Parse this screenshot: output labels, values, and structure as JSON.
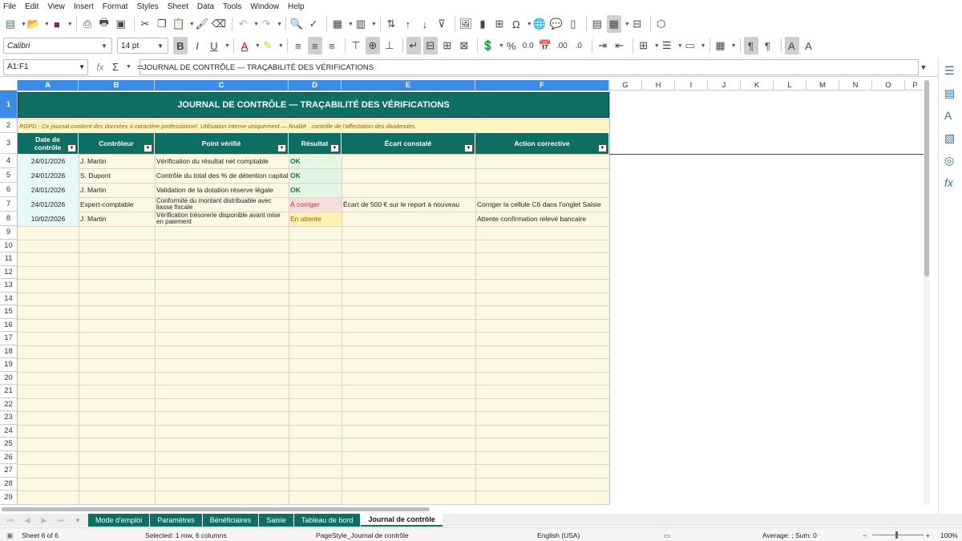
{
  "menu": [
    "File",
    "Edit",
    "View",
    "Insert",
    "Format",
    "Styles",
    "Sheet",
    "Data",
    "Tools",
    "Window",
    "Help"
  ],
  "format": {
    "font": "Calibri",
    "size": "14 pt"
  },
  "formula_bar": {
    "cell_ref": "A1:F1",
    "content": "JOURNAL DE CONTRÔLE — TRAÇABILITÉ DES VÉRIFICATIONS"
  },
  "columns": [
    "A",
    "B",
    "C",
    "D",
    "E",
    "F",
    "G",
    "H",
    "I",
    "J",
    "K",
    "L",
    "M",
    "N",
    "O",
    "P"
  ],
  "rows": [
    "1",
    "2",
    "3",
    "4",
    "5",
    "6",
    "7",
    "8",
    "9",
    "10",
    "11",
    "12",
    "13",
    "14",
    "15",
    "16",
    "17",
    "18",
    "19",
    "20",
    "21",
    "22",
    "23",
    "24",
    "25",
    "26",
    "27",
    "28",
    "29"
  ],
  "sheet": {
    "title": "JOURNAL DE CONTRÔLE — TRAÇABILITÉ DES VÉRIFICATIONS",
    "note": "RGPD : Ce journal contient des données à caractère professionnel. Utilisation interne uniquement — finalité : contrôle de l'affectation des dividendes.",
    "headers": [
      "Date de contrôle",
      "Contrôleur",
      "Point vérifié",
      "Résultat",
      "Écart constaté",
      "Action corrective"
    ],
    "data": [
      [
        "24/01/2026",
        "J. Martin",
        "Vérification du résultat net comptable",
        "OK",
        "",
        ""
      ],
      [
        "24/01/2026",
        "S. Dupont",
        "Contrôle du total des % de détention capital",
        "OK",
        "",
        ""
      ],
      [
        "24/01/2026",
        "J. Martin",
        "Validation de la dotation réserve légale",
        "OK",
        "",
        ""
      ],
      [
        "24/01/2026",
        "Expert-comptable",
        "Conformité du montant distribuable avec liasse fiscale",
        "À corriger",
        "Écart de 500 € sur le report à nouveau",
        "Corriger la cellule C6 dans l'onglet Saisie"
      ],
      [
        "10/02/2026",
        "J. Martin",
        "Vérification trésorerie disponible avant mise en paiement",
        "En attente",
        "",
        "Attente confirmation relevé bancaire"
      ]
    ]
  },
  "tabs": [
    "Mode d'emploi",
    "Paramètres",
    "Bénéficiaires",
    "Saisie",
    "Tableau de bord",
    "Journal de contrôle"
  ],
  "status": {
    "sheet": "Sheet 6 of 6",
    "selection": "Selected: 1 row, 6 columns",
    "page_style": "PageStyle_Journal de contrôle",
    "language": "English (USA)",
    "sum": "Average: ; Sum: 0",
    "zoom": "100%"
  }
}
